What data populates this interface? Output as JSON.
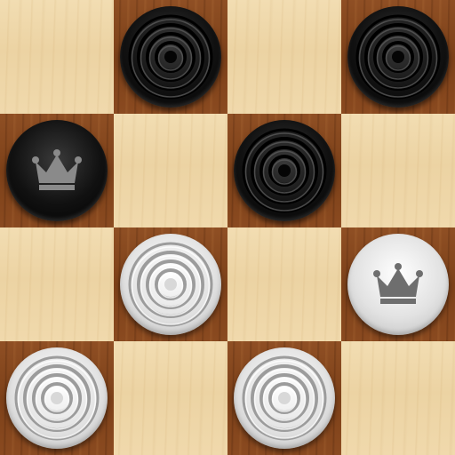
{
  "board": {
    "light_color": "#ecd3a3",
    "dark_color": "#7d4119",
    "rows": [
      [
        "light",
        "dark",
        "light",
        "dark"
      ],
      [
        "dark",
        "light",
        "dark",
        "light"
      ],
      [
        "light",
        "dark",
        "light",
        "dark"
      ],
      [
        "dark",
        "light",
        "dark",
        "light"
      ]
    ]
  },
  "pieces": [
    {
      "row": 0,
      "col": 1,
      "color": "black",
      "king": false
    },
    {
      "row": 0,
      "col": 3,
      "color": "black",
      "king": false
    },
    {
      "row": 1,
      "col": 0,
      "color": "black",
      "king": true
    },
    {
      "row": 1,
      "col": 2,
      "color": "black",
      "king": false
    },
    {
      "row": 2,
      "col": 1,
      "color": "white",
      "king": false
    },
    {
      "row": 2,
      "col": 3,
      "color": "white",
      "king": true
    },
    {
      "row": 3,
      "col": 0,
      "color": "white",
      "king": false
    },
    {
      "row": 3,
      "col": 2,
      "color": "white",
      "king": false
    }
  ],
  "icons": {
    "king": "crown-icon",
    "man": "rings-icon"
  }
}
